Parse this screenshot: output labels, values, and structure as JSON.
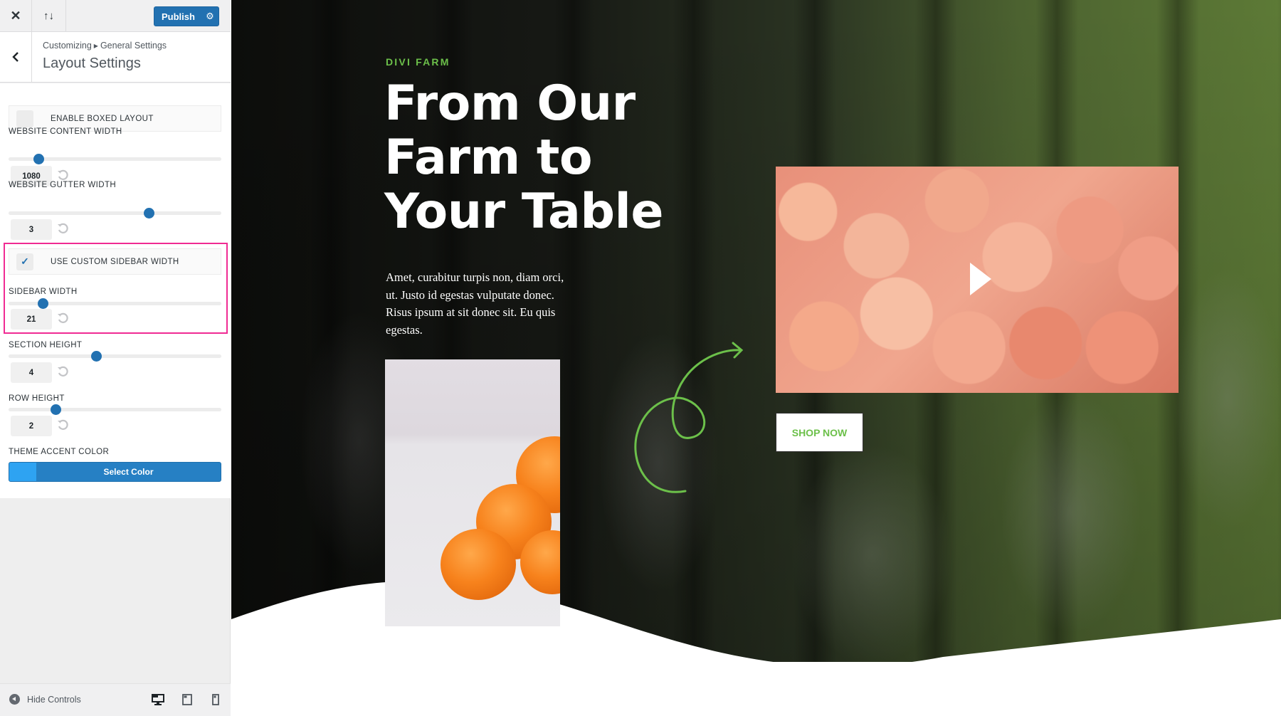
{
  "customizer": {
    "close_icon": "close-icon",
    "reorder_icon": "reorder-arrows-icon",
    "publish_label": "Publish",
    "publish_settings_icon": "gear-icon",
    "breadcrumb": {
      "root": "Customizing",
      "separator_icon": "triangle-right-icon",
      "parent": "General Settings"
    },
    "section_title": "Layout Settings",
    "controls": {
      "enable_boxed_layout": {
        "label": "ENABLE BOXED LAYOUT",
        "checked": false
      },
      "website_content_width": {
        "label": "WEBSITE CONTENT WIDTH",
        "value": "1080",
        "slider_fraction": 0.14
      },
      "website_gutter_width": {
        "label": "WEBSITE GUTTER WIDTH",
        "value": "3",
        "slider_fraction": 0.66
      },
      "use_custom_sidebar_width": {
        "label": "USE CUSTOM SIDEBAR WIDTH",
        "checked": true,
        "check_glyph": "✓"
      },
      "sidebar_width": {
        "label": "SIDEBAR WIDTH",
        "value": "21",
        "slider_fraction": 0.16
      },
      "section_height": {
        "label": "SECTION HEIGHT",
        "value": "4",
        "slider_fraction": 0.41
      },
      "row_height": {
        "label": "ROW HEIGHT",
        "value": "2",
        "slider_fraction": 0.22
      },
      "theme_accent_color": {
        "label": "THEME ACCENT COLOR",
        "button_label": "Select Color",
        "color": "#2ea3f2"
      }
    },
    "footer": {
      "hide_controls_label": "Hide Controls",
      "devices": [
        "desktop",
        "tablet",
        "mobile"
      ],
      "active_device": "desktop"
    },
    "highlight_color": "#f02b93",
    "accent": "#2271b1"
  },
  "preview": {
    "eyebrow": "DIVI FARM",
    "headline_lines": [
      "From Our",
      "Farm to",
      "Your Table"
    ],
    "body": "Amet, curabitur turpis non, diam orci, ut. Justo id egestas vulputate donec. Risus ipsum at sit donec sit. Eu quis egestas.",
    "cta_label": "SHOP NOW",
    "brand_green": "#6cc04a",
    "video_play_icon": "play-icon",
    "video_subject": "peaches",
    "photo_subject": "oranges"
  }
}
